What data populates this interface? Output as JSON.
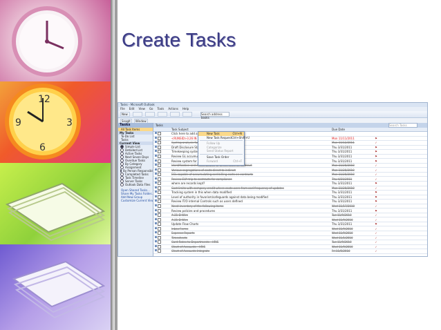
{
  "slide": {
    "title": "Create Tasks"
  },
  "colors": {
    "title": "#3d3d86",
    "accent": "#fbd98a",
    "overdue": "#d11111"
  },
  "outlook": {
    "window_title": "Tasks - Microsoft Outlook",
    "menu": [
      "File",
      "Edit",
      "View",
      "Go",
      "Tools",
      "Actions",
      "Help"
    ],
    "toolbar": {
      "new": "New",
      "search_placeholder": "Search address books"
    },
    "toolbar2": {
      "snagit": "SnagIt",
      "window": "Window"
    },
    "nav": {
      "header": "Tasks",
      "all_items": "All Task Items",
      "my_tasks": "My Tasks",
      "my_tasks_items": [
        "To-Do List",
        "Tasks"
      ],
      "current_view": "Current View",
      "views": [
        "Simple List",
        "Detailed List",
        "Active Tasks",
        "Next Seven Days",
        "Overdue Tasks",
        "By Category",
        "Assignment",
        "By Person Responsible",
        "Completed Tasks",
        "Task Timeline",
        "Server Tasks",
        "Outlook Data Files"
      ],
      "links": [
        "Open Shared Tasks...",
        "Share My Tasks Folder...",
        "Add New Group",
        "Customize Current View..."
      ]
    },
    "main": {
      "header": "Tasks",
      "search_placeholder": "Search Tasks",
      "col_subject": "Task Subject",
      "col_due": "Due Date"
    },
    "tasks": [
      {
        "subject": "Click here to add a new Task",
        "due": "",
        "state": "new"
      },
      {
        "subject": "<RUNSID>3.26 IN LUNGERS/4",
        "due": "Mon 11/11/2011",
        "state": "red"
      },
      {
        "subject": "Cycling analysis for file",
        "due": "Mon 11/12/2011",
        "state": "done"
      },
      {
        "subject": "Draft Disclosure Statement with Shelia",
        "due": "Thu 3/31/2011",
        "state": "open"
      },
      {
        "subject": "Timekeeping system",
        "due": "Thu 3/31/2011",
        "state": "open"
      },
      {
        "subject": "Review GL accumulation of costs",
        "due": "Thu 3/31/2011",
        "state": "open"
      },
      {
        "subject": "Review system for allocation of market costs",
        "due": "Thu 3/31/2011",
        "state": "open"
      },
      {
        "subject": "Identification and accumulation of direct costs as contract",
        "due": "Mon 11/28/2010",
        "state": "done"
      },
      {
        "subject": "Various segregations of costs direct to indirect",
        "due": "Mon 11/28/2010",
        "state": "done"
      },
      {
        "subject": "ECL capable of accumulating and billing costs on contracts",
        "due": "Mon 11/28/2010",
        "state": "done"
      },
      {
        "subject": "Review EVA trip to contracts for compliance",
        "due": "Thu 4/21/2011",
        "state": "done"
      },
      {
        "subject": "where are records kept?",
        "due": "Thu 3/31/2011",
        "state": "open"
      },
      {
        "subject": "Cost limits with company credit where costs were from and frequency of updates",
        "due": "Mon 11/28/2010",
        "state": "done"
      },
      {
        "subject": "Tracking system in this when data modified",
        "due": "Thu 3/31/2011",
        "state": "open"
      },
      {
        "subject": "Level of authority in favorism/safeguards against data being modified",
        "due": "Thu 3/31/2011",
        "state": "open"
      },
      {
        "subject": "Review IT/O internal Controls such as users defined",
        "due": "Thu 3/31/2011",
        "state": "open"
      },
      {
        "subject": "Need inventory of the following items",
        "due": "Wed 11/17/2010",
        "state": "done"
      },
      {
        "subject": "Review policies and procedures",
        "due": "Thu 3/31/2011",
        "state": "open"
      },
      {
        "subject": "A-21-D-Wire",
        "due": "Tue 11/9/2010",
        "state": "done"
      },
      {
        "subject": "A-21-D-Wire",
        "due": "Wed 11/9/2010",
        "state": "done"
      },
      {
        "subject": "Update Flow Charts",
        "due": "Thu 3/31/2011",
        "state": "open"
      },
      {
        "subject": "Inbox Forms",
        "due": "Wed 11/9/2010",
        "state": "done"
      },
      {
        "subject": "Expense Reports",
        "due": "Wed 11/9/2010",
        "state": "done"
      },
      {
        "subject": "Timesheets",
        "due": "Wed 11/1/2010",
        "state": "done"
      },
      {
        "subject": "Card Rates to Departments - HRIS",
        "due": "Tue 11/9/2010",
        "state": "done"
      },
      {
        "subject": "Chart of Accounts - HRIS",
        "due": "Wed 11/9/2010",
        "state": "done"
      },
      {
        "subject": "Chart of Accounts Integrate",
        "due": "Fri 11/5/2010",
        "state": "done"
      }
    ],
    "new_menu": {
      "items": [
        {
          "label": "New Task",
          "shortcut": "Ctrl+N",
          "state": "highlight"
        },
        {
          "label": "New Task Request",
          "shortcut": "Ctrl+Shift+U",
          "state": "normal"
        },
        {
          "label": "Follow Up",
          "shortcut": "",
          "state": "disabled"
        },
        {
          "label": "Categorize",
          "shortcut": "",
          "state": "disabled"
        },
        {
          "label": "Send Status Report",
          "shortcut": "",
          "state": "disabled"
        },
        {
          "label": "Save Task Order",
          "shortcut": "",
          "state": "normal"
        },
        {
          "label": "Forward",
          "shortcut": "Ctrl+F",
          "state": "disabled"
        }
      ]
    }
  }
}
